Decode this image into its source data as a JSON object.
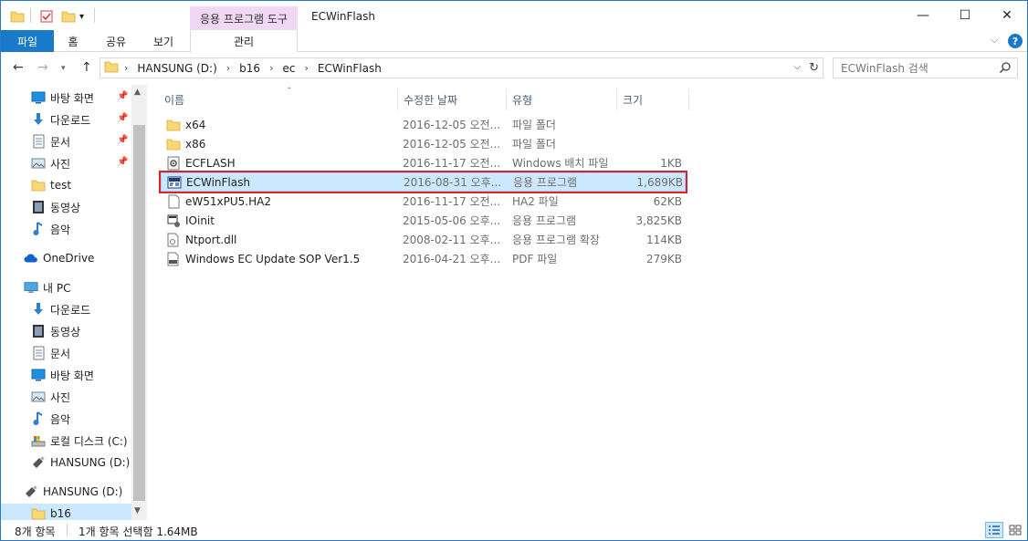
{
  "titlebar": {
    "title": "ECWinFlash",
    "tool_tab": "응용 프로그램 도구",
    "minimize": "—",
    "maximize": "☐",
    "close": "✕"
  },
  "ribbon": {
    "tabs": {
      "file": "파일",
      "home": "홈",
      "share": "공유",
      "view": "보기",
      "manage": "관리"
    },
    "help": "?"
  },
  "address": {
    "crumbs": [
      "HANSUNG (D:)",
      "b16",
      "ec",
      "ECWinFlash"
    ],
    "search_placeholder": "ECWinFlash 검색"
  },
  "nav": {
    "items": [
      {
        "label": "바탕 화면",
        "icon": "desktop-icon",
        "pinned": true
      },
      {
        "label": "다운로드",
        "icon": "download-icon",
        "pinned": true
      },
      {
        "label": "문서",
        "icon": "document-icon",
        "pinned": true
      },
      {
        "label": "사진",
        "icon": "pictures-icon",
        "pinned": true
      },
      {
        "label": "test",
        "icon": "folder-icon",
        "pinned": false
      },
      {
        "label": "동영상",
        "icon": "video-icon",
        "pinned": false
      },
      {
        "label": "음악",
        "icon": "music-icon",
        "pinned": false
      },
      {
        "label": "OneDrive",
        "icon": "onedrive-icon",
        "pinned": false
      },
      {
        "label": "내 PC",
        "icon": "pc-icon",
        "pinned": false
      },
      {
        "label": "다운로드",
        "icon": "download-icon",
        "pinned": false
      },
      {
        "label": "동영상",
        "icon": "video-icon",
        "pinned": false
      },
      {
        "label": "문서",
        "icon": "document-icon",
        "pinned": false
      },
      {
        "label": "바탕 화면",
        "icon": "desktop-icon",
        "pinned": false
      },
      {
        "label": "사진",
        "icon": "pictures-icon",
        "pinned": false
      },
      {
        "label": "음악",
        "icon": "music-icon",
        "pinned": false
      },
      {
        "label": "로컬 디스크 (C:)",
        "icon": "local-disk-icon",
        "pinned": false
      },
      {
        "label": "HANSUNG (D:)",
        "icon": "usb-drive-icon",
        "pinned": false
      },
      {
        "label": "HANSUNG (D:)",
        "icon": "usb-drive-icon",
        "pinned": false
      },
      {
        "label": "b16",
        "icon": "folder-icon",
        "pinned": false
      }
    ]
  },
  "list": {
    "columns": {
      "name": "이름",
      "date": "수정한 날짜",
      "type": "유형",
      "size": "크기"
    },
    "rows": [
      {
        "name": "x64",
        "date": "2016-12-05 오전...",
        "type": "파일 폴더",
        "size": "",
        "icon": "folder-icon"
      },
      {
        "name": "x86",
        "date": "2016-12-05 오전...",
        "type": "파일 폴더",
        "size": "",
        "icon": "folder-icon"
      },
      {
        "name": "ECFLASH",
        "date": "2016-11-17 오전...",
        "type": "Windows 배치 파일",
        "size": "1KB",
        "icon": "batch-file-icon"
      },
      {
        "name": "ECWinFlash",
        "date": "2016-08-31 오후...",
        "type": "응용 프로그램",
        "size": "1,689KB",
        "icon": "ecwinflash-app-icon"
      },
      {
        "name": "eW51xPU5.HA2",
        "date": "2016-11-17 오전...",
        "type": "HA2 파일",
        "size": "62KB",
        "icon": "blank-file-icon"
      },
      {
        "name": "IOinit",
        "date": "2015-05-06 오후...",
        "type": "응용 프로그램",
        "size": "3,825KB",
        "icon": "app-icon"
      },
      {
        "name": "Ntport.dll",
        "date": "2008-02-11 오후...",
        "type": "응용 프로그램 확장",
        "size": "114KB",
        "icon": "dll-file-icon"
      },
      {
        "name": "Windows EC Update SOP Ver1.5",
        "date": "2016-04-21 오후...",
        "type": "PDF 파일",
        "size": "279KB",
        "icon": "pdf-file-icon"
      }
    ]
  },
  "status": {
    "count": "8개 항목",
    "selection": "1개 항목 선택함 1.64MB"
  },
  "colors": {
    "accent": "#1979ca",
    "selection": "#cce8ff",
    "highlight_border": "#e0202a",
    "folder": "#f8d775",
    "tool_tab": "#f0d7f5"
  }
}
